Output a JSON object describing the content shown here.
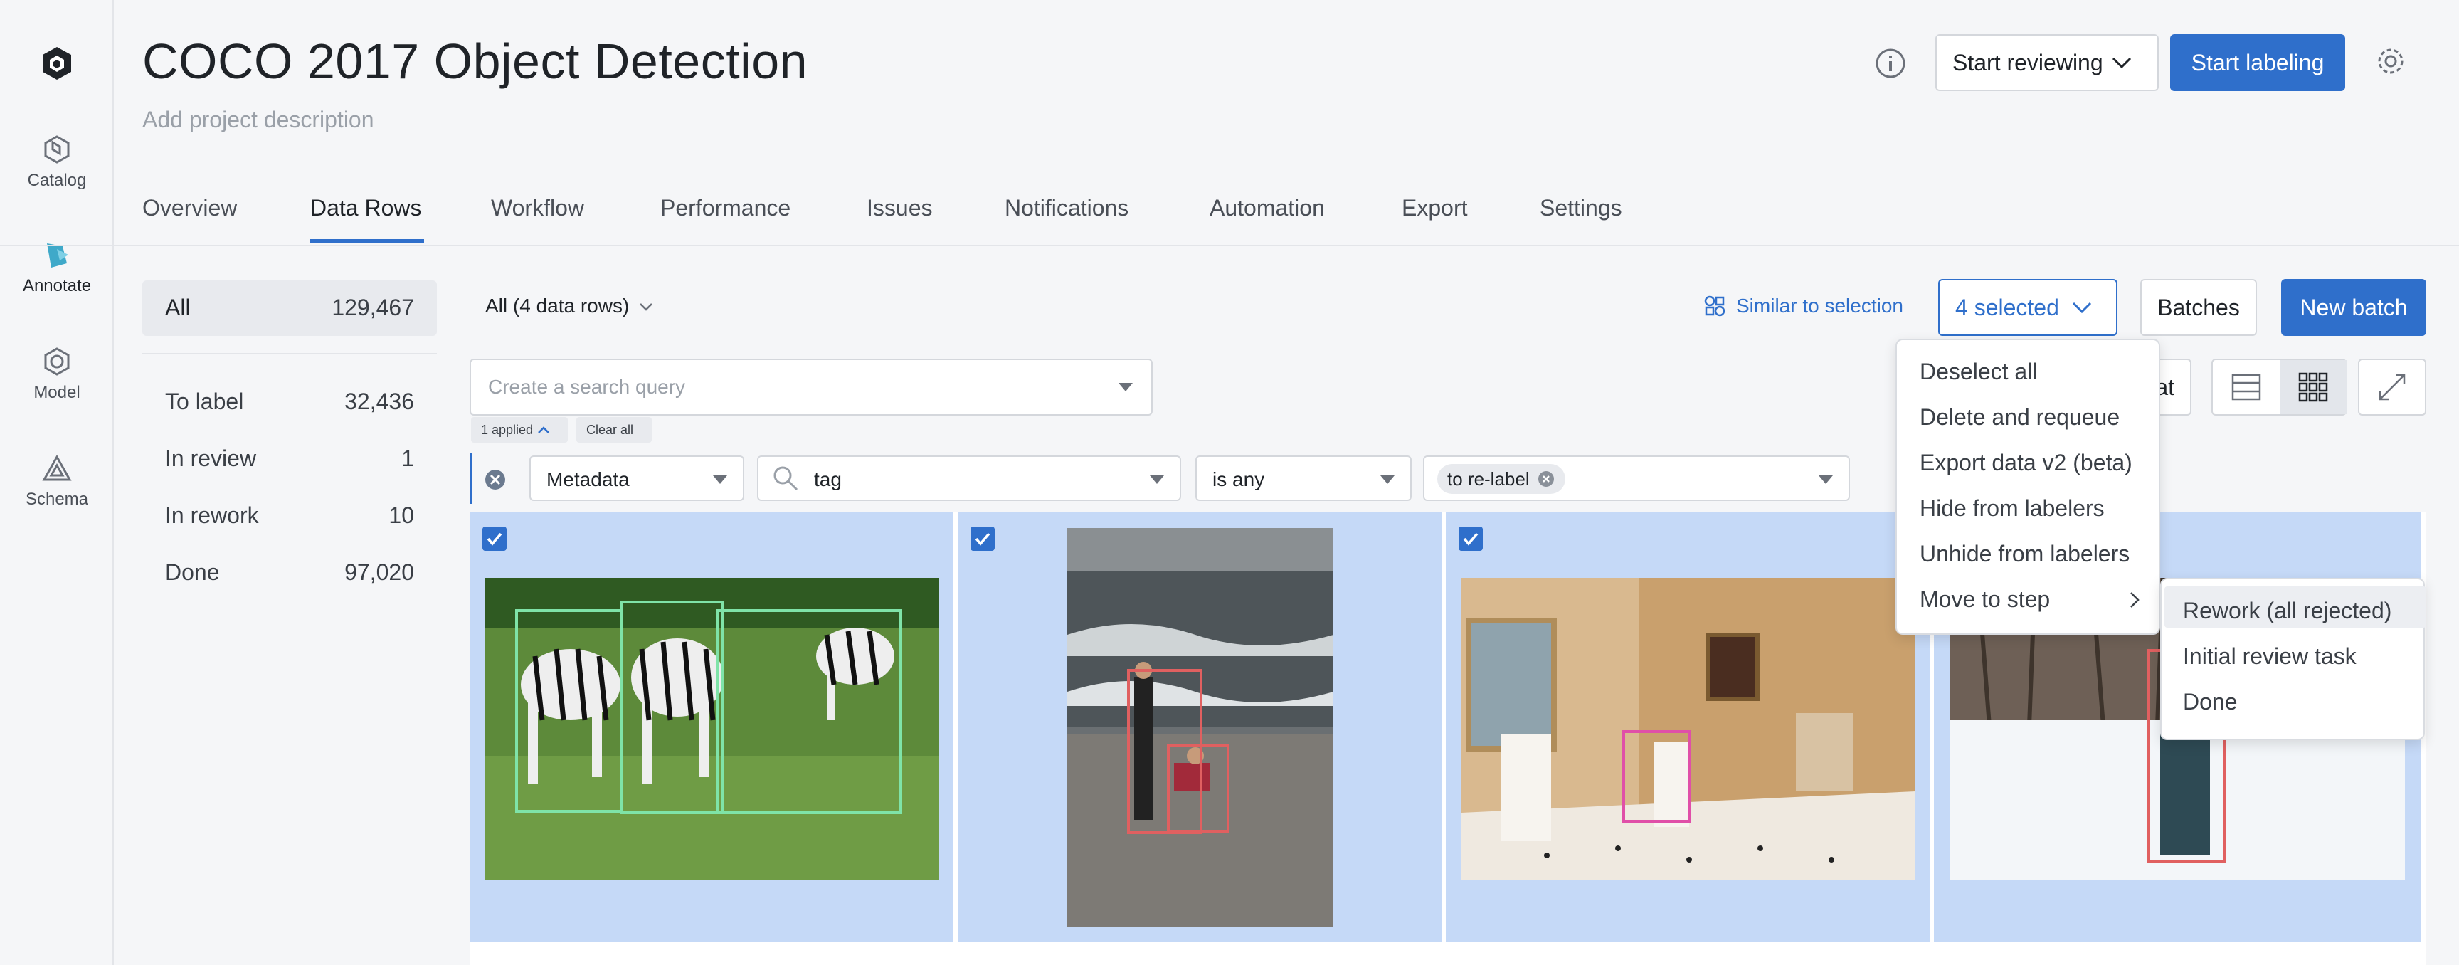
{
  "rail": {
    "items": [
      {
        "label": "Catalog"
      },
      {
        "label": "Annotate"
      },
      {
        "label": "Model"
      },
      {
        "label": "Schema"
      }
    ]
  },
  "header": {
    "title": "COCO 2017 Object Detection",
    "description_placeholder": "Add project description",
    "start_reviewing": "Start reviewing",
    "start_labeling": "Start labeling"
  },
  "tabs": [
    "Overview",
    "Data Rows",
    "Workflow",
    "Performance",
    "Issues",
    "Notifications",
    "Automation",
    "Export",
    "Settings"
  ],
  "stats": {
    "all_label": "All",
    "all_value": "129,467",
    "rows": [
      {
        "label": "To label",
        "value": "32,436"
      },
      {
        "label": "In review",
        "value": "1"
      },
      {
        "label": "In rework",
        "value": "10"
      },
      {
        "label": "Done",
        "value": "97,020"
      }
    ]
  },
  "toolbar": {
    "scope": "All (4 data rows)",
    "similar": "Similar to selection",
    "selected": "4 selected",
    "batches": "Batches",
    "new_batch": "New batch",
    "partial_label": "at"
  },
  "search": {
    "placeholder": "Create a search query",
    "applied": "1 applied",
    "clear_all": "Clear all"
  },
  "filter": {
    "field": "Metadata",
    "key": "tag",
    "operator": "is any",
    "value": "to re-label"
  },
  "selection_menu": {
    "items": [
      "Deselect all",
      "Delete and requeue",
      "Export data v2 (beta)",
      "Hide from labelers",
      "Unhide from labelers",
      "Move to step"
    ]
  },
  "submenu": {
    "items": [
      "Rework (all rejected)",
      "Initial review task",
      "Done"
    ]
  },
  "colors": {
    "accent": "#2f6fcb",
    "tile_selected": "#c5d9f7"
  }
}
